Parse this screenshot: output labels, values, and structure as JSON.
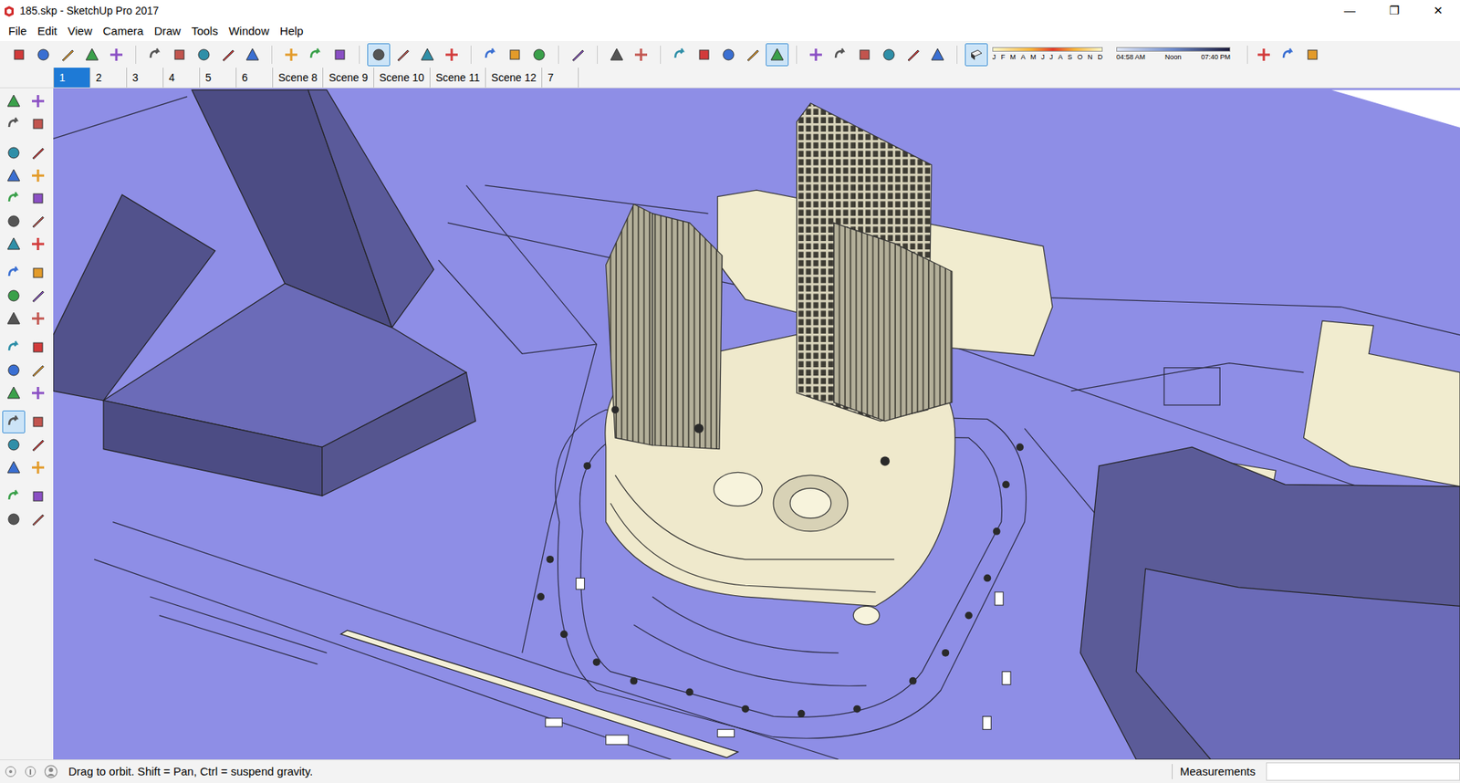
{
  "window": {
    "title": "185.skp - SketchUp Pro 2017",
    "controls": [
      "—",
      "❐",
      "✕"
    ]
  },
  "menu": [
    "File",
    "Edit",
    "View",
    "Camera",
    "Draw",
    "Tools",
    "Window",
    "Help"
  ],
  "top_toolbar": [
    {
      "selected": false
    },
    {
      "selected": false
    },
    {
      "selected": false
    },
    {
      "selected": false
    },
    {
      "selected": false
    },
    {
      "selected": false
    },
    {
      "selected": false
    },
    {
      "selected": false
    },
    {
      "selected": false
    },
    {
      "selected": false
    },
    {
      "selected": false
    },
    {
      "selected": false
    },
    {
      "selected": false
    },
    {
      "selected": true
    },
    {
      "selected": false
    },
    {
      "selected": false
    },
    {
      "selected": false
    },
    {
      "selected": false
    },
    {
      "selected": false
    },
    {
      "selected": false
    },
    {
      "selected": false
    },
    {
      "selected": false
    },
    {
      "selected": false
    },
    {
      "selected": false
    },
    {
      "selected": false
    },
    {
      "selected": false
    },
    {
      "selected": false
    },
    {
      "selected": true
    },
    {
      "selected": false
    },
    {
      "selected": false
    },
    {
      "selected": false
    },
    {
      "selected": false
    },
    {
      "selected": false
    },
    {
      "selected": false
    }
  ],
  "shadows": {
    "on": true,
    "months": [
      "J",
      "F",
      "M",
      "A",
      "M",
      "J",
      "J",
      "A",
      "S",
      "O",
      "N",
      "D"
    ],
    "times": [
      "04:58 AM",
      "Noon",
      "07:40 PM"
    ]
  },
  "extra_toolbar": [
    {
      "selected": false
    },
    {
      "selected": false
    },
    {
      "selected": false
    }
  ],
  "scenes": [
    {
      "label": "1",
      "selected": true
    },
    {
      "label": "2",
      "selected": false
    },
    {
      "label": "3",
      "selected": false
    },
    {
      "label": "4",
      "selected": false
    },
    {
      "label": "5",
      "selected": false
    },
    {
      "label": "6",
      "selected": false
    },
    {
      "label": "Scene 8",
      "selected": false
    },
    {
      "label": "Scene 9",
      "selected": false
    },
    {
      "label": "Scene 10",
      "selected": false
    },
    {
      "label": "Scene 11",
      "selected": false
    },
    {
      "label": "Scene 12",
      "selected": false
    },
    {
      "label": "7",
      "selected": false
    }
  ],
  "left_toolbar": [
    {
      "selected": false
    },
    {
      "selected": false
    },
    {
      "selected": false
    },
    {
      "selected": false
    },
    {
      "selected": false
    },
    {
      "selected": false
    },
    {
      "selected": false
    },
    {
      "selected": false
    },
    {
      "selected": false
    },
    {
      "selected": false
    },
    {
      "selected": false
    },
    {
      "selected": false
    },
    {
      "selected": false
    },
    {
      "selected": false
    },
    {
      "selected": false
    },
    {
      "selected": false
    },
    {
      "selected": false
    },
    {
      "selected": false
    },
    {
      "selected": false
    },
    {
      "selected": false
    },
    {
      "selected": false
    },
    {
      "selected": false
    },
    {
      "selected": false
    },
    {
      "selected": false
    },
    {
      "selected": false
    },
    {
      "selected": false
    },
    {
      "selected": true
    },
    {
      "selected": false
    },
    {
      "selected": false
    },
    {
      "selected": false
    },
    {
      "selected": false
    },
    {
      "selected": false
    },
    {
      "selected": false
    },
    {
      "selected": false
    },
    {
      "selected": false
    },
    {
      "selected": false
    }
  ],
  "status_bar": {
    "hint": "Drag to orbit. Shift = Pan, Ctrl = suspend gravity.",
    "measurements_label": "Measurements",
    "measurements_value": ""
  }
}
